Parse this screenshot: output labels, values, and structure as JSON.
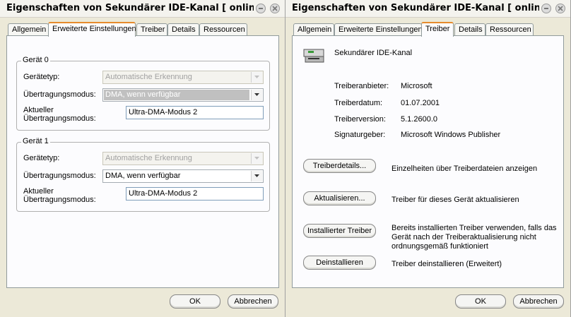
{
  "left": {
    "title": "Eigenschaften von Sekundärer IDE-Kanal   [   onlin...",
    "tabs": [
      "Allgemein",
      "Erweiterte Einstellungen",
      "Treiber",
      "Details",
      "Ressourcen"
    ],
    "device0": {
      "legend": "Gerät 0",
      "type_label": "Gerätetyp:",
      "type_value": "Automatische Erkennung",
      "mode_label": "Übertragungsmodus:",
      "mode_value": "DMA, wenn verfügbar",
      "current_label_1": "Aktueller",
      "current_label_2": "Übertragungsmodus:",
      "current_value": "Ultra-DMA-Modus 2"
    },
    "device1": {
      "legend": "Gerät 1",
      "type_label": "Gerätetyp:",
      "type_value": "Automatische Erkennung",
      "mode_label": "Übertragungsmodus:",
      "mode_value": "DMA, wenn verfügbar",
      "current_label_1": "Aktueller",
      "current_label_2": "Übertragungsmodus:",
      "current_value": "Ultra-DMA-Modus 2"
    },
    "ok": "OK",
    "cancel": "Abbrechen"
  },
  "right": {
    "title": "Eigenschaften von Sekundärer IDE-Kanal   [   onlin...",
    "tabs": [
      "Allgemein",
      "Erweiterte Einstellungen",
      "Treiber",
      "Details",
      "Ressourcen"
    ],
    "device_name": "Sekundärer IDE-Kanal",
    "info": [
      {
        "label": "Treiberanbieter:",
        "value": "Microsoft"
      },
      {
        "label": "Treiberdatum:",
        "value": "01.07.2001"
      },
      {
        "label": "Treiberversion:",
        "value": "5.1.2600.0"
      },
      {
        "label": "Signaturgeber:",
        "value": "Microsoft Windows Publisher"
      }
    ],
    "actions": [
      {
        "button": "Treiberdetails...",
        "desc": "Einzelheiten über Treiberdateien anzeigen"
      },
      {
        "button": "Aktualisieren...",
        "desc": "Treiber für dieses Gerät aktualisieren"
      },
      {
        "button": "Installierter Treiber",
        "desc1": "Bereits installierten Treiber verwenden, falls das",
        "desc2": "Gerät nach der Treiberaktualisierung nicht",
        "desc3": "ordnungsgemäß funktioniert"
      },
      {
        "button": "Deinstallieren",
        "desc": "Treiber deinstallieren (Erweitert)"
      }
    ],
    "ok": "OK",
    "cancel": "Abbrechen"
  }
}
